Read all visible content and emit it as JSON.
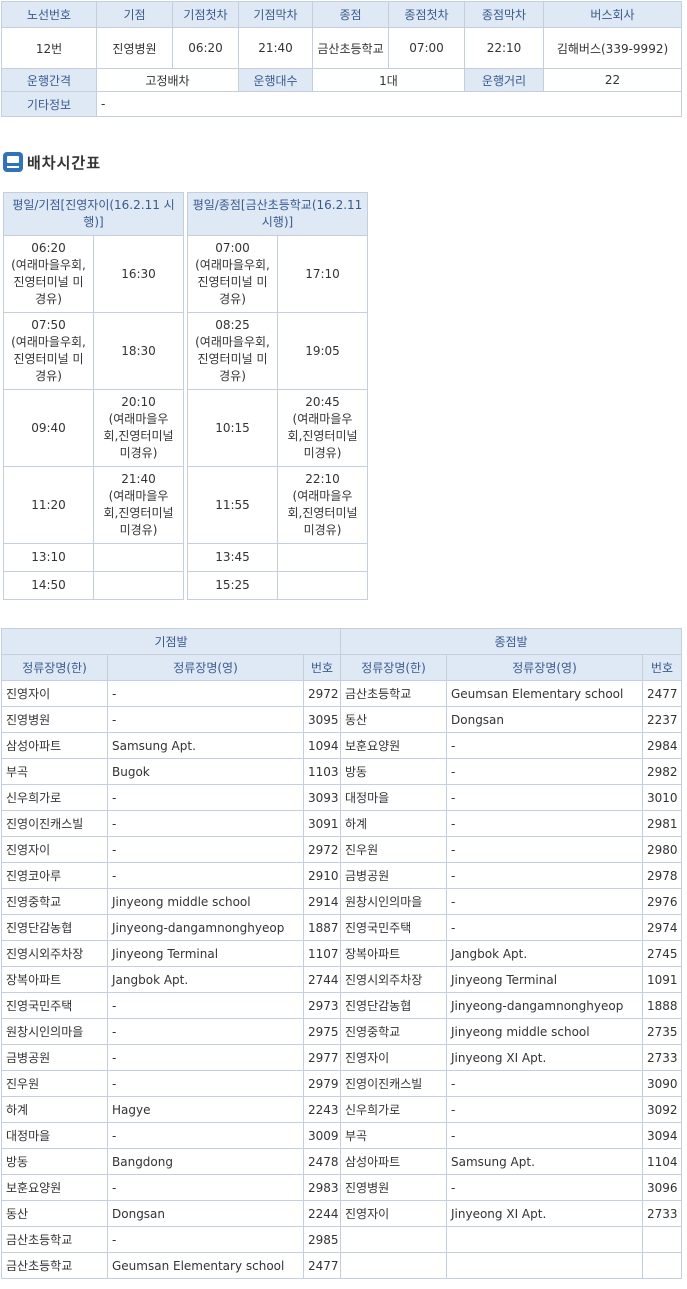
{
  "info": {
    "headers": [
      "노선번호",
      "기점",
      "기점첫차",
      "기점막차",
      "종점",
      "종점첫차",
      "종점막차",
      "버스회사"
    ],
    "route_no": "12번",
    "start": "진영병원",
    "start_first": "06:20",
    "start_last": "21:40",
    "end": "금산초등학교",
    "end_first": "07:00",
    "end_last": "22:10",
    "company": "김해버스(339-9992)",
    "interval_label": "운행간격",
    "interval_value": "고정배차",
    "count_label": "운행대수",
    "count_value": "1대",
    "distance_label": "운행거리",
    "distance_value": "22",
    "etc_label": "기타정보",
    "etc_value": "-"
  },
  "schedule": {
    "title": "배차시간표",
    "icon": "bus-icon",
    "left": {
      "header": "평일/기점[진영자이(16.2.11 시행)]",
      "rows": [
        [
          "06:20\n(여래마을우회,\n진영터미널 미\n경유)",
          "16:30"
        ],
        [
          "07:50\n(여래마을우회,\n진영터미널 미\n경유)",
          "18:30"
        ],
        [
          "09:40",
          "20:10\n(여래마을우\n회,진영터미널\n미경유)"
        ],
        [
          "11:20",
          "21:40\n(여래마을우\n회,진영터미널\n미경유)"
        ],
        [
          "13:10",
          ""
        ],
        [
          "14:50",
          ""
        ]
      ]
    },
    "right": {
      "header": "평일/종점[금산초등학교(16.2.11 시행)]",
      "rows": [
        [
          "07:00\n(여래마을우회,\n진영터미널 미\n경유)",
          "17:10"
        ],
        [
          "08:25\n(여래마을우회,\n진영터미널 미\n경유)",
          "19:05"
        ],
        [
          "10:15",
          "20:45\n(여래마을우\n회,진영터미널\n미경유)"
        ],
        [
          "11:55",
          "22:10\n(여래마을우\n회,진영터미널\n미경유)"
        ],
        [
          "13:45",
          ""
        ],
        [
          "15:25",
          ""
        ]
      ]
    }
  },
  "stops": {
    "group_start": "기점발",
    "group_end": "종점발",
    "col_kr": "정류장명(한)",
    "col_en": "정류장명(영)",
    "col_no": "번호",
    "start_rows": [
      [
        "진영자이",
        "-",
        "2972"
      ],
      [
        "진영병원",
        "-",
        "3095"
      ],
      [
        "삼성아파트",
        "Samsung Apt.",
        "1094"
      ],
      [
        "부곡",
        "Bugok",
        "1103"
      ],
      [
        "신우희가로",
        "-",
        "3093"
      ],
      [
        "진영이진캐스빌",
        "-",
        "3091"
      ],
      [
        "진영자이",
        "-",
        "2972"
      ],
      [
        "진영코아루",
        "-",
        "2910"
      ],
      [
        "진영중학교",
        "Jinyeong middle school",
        "2914"
      ],
      [
        "진영단감농협",
        "Jinyeong-dangamnonghyeop",
        "1887"
      ],
      [
        "진영시외주차장",
        "Jinyeong Terminal",
        "1107"
      ],
      [
        "장복아파트",
        "Jangbok Apt.",
        "2744"
      ],
      [
        "진영국민주택",
        "-",
        "2973"
      ],
      [
        "원창시인의마을",
        "-",
        "2975"
      ],
      [
        "금병공원",
        "-",
        "2977"
      ],
      [
        "진우원",
        "-",
        "2979"
      ],
      [
        "하계",
        "Hagye",
        "2243"
      ],
      [
        "대정마을",
        "-",
        "3009"
      ],
      [
        "방동",
        "Bangdong",
        "2478"
      ],
      [
        "보훈요양원",
        "-",
        "2983"
      ],
      [
        "동산",
        "Dongsan",
        "2244"
      ],
      [
        "금산초등학교",
        "-",
        "2985"
      ],
      [
        "금산초등학교",
        "Geumsan Elementary school",
        "2477"
      ]
    ],
    "end_rows": [
      [
        "금산초등학교",
        "Geumsan Elementary school",
        "2477"
      ],
      [
        "동산",
        "Dongsan",
        "2237"
      ],
      [
        "보훈요양원",
        "-",
        "2984"
      ],
      [
        "방동",
        "-",
        "2982"
      ],
      [
        "대정마을",
        "-",
        "3010"
      ],
      [
        "하계",
        "-",
        "2981"
      ],
      [
        "진우원",
        "-",
        "2980"
      ],
      [
        "금병공원",
        "-",
        "2978"
      ],
      [
        "원창시인의마을",
        "-",
        "2976"
      ],
      [
        "진영국민주택",
        "-",
        "2974"
      ],
      [
        "장복아파트",
        "Jangbok Apt.",
        "2745"
      ],
      [
        "진영시외주차장",
        "Jinyeong Terminal",
        "1091"
      ],
      [
        "진영단감농협",
        "Jinyeong-dangamnonghyeop",
        "1888"
      ],
      [
        "진영중학교",
        "Jinyeong middle school",
        "2735"
      ],
      [
        "진영자이",
        "Jinyeong XI Apt.",
        "2733"
      ],
      [
        "진영이진캐스빌",
        "-",
        "3090"
      ],
      [
        "신우희가로",
        "-",
        "3092"
      ],
      [
        "부곡",
        "-",
        "3094"
      ],
      [
        "삼성아파트",
        "Samsung Apt.",
        "1104"
      ],
      [
        "진영병원",
        "-",
        "3096"
      ],
      [
        "진영자이",
        "Jinyeong XI Apt.",
        "2733"
      ],
      [
        "",
        "",
        ""
      ],
      [
        "",
        "",
        ""
      ]
    ]
  }
}
